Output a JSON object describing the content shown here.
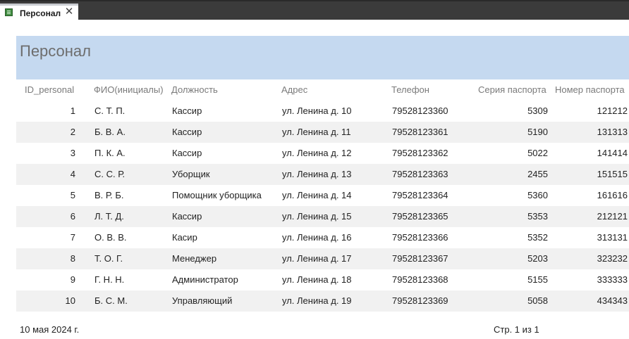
{
  "tab": {
    "label": "Персонал",
    "icon": "report-icon",
    "close_icon": "close-icon"
  },
  "report": {
    "title": "Персонал",
    "header_color": "#c5d9f0",
    "columns": [
      "ID_personal",
      "ФИО(инициалы)",
      "Должность",
      "Адрес",
      "Телефон",
      "Серия паспорта",
      "Номер паспорта"
    ],
    "rows": [
      [
        "1",
        "С. Т. П.",
        "Кассир",
        "ул. Ленина д. 10",
        "79528123360",
        "5309",
        "121212"
      ],
      [
        "2",
        "Б. В. А.",
        "Кассир",
        "ул. Ленина д. 11",
        "79528123361",
        "5190",
        "131313"
      ],
      [
        "3",
        "П. К. А.",
        "Кассир",
        "ул. Ленина д. 12",
        "79528123362",
        "5022",
        "141414"
      ],
      [
        "4",
        "С. С. Р.",
        "Уборщик",
        "ул. Ленина д. 13",
        "79528123363",
        "2455",
        "151515"
      ],
      [
        "5",
        "В. Р. Б.",
        "Помощник уборщика",
        "ул. Ленина д. 14",
        "79528123364",
        "5360",
        "161616"
      ],
      [
        "6",
        "Л. Т. Д.",
        "Кассир",
        "ул. Ленина д. 15",
        "79528123365",
        "5353",
        "212121"
      ],
      [
        "7",
        "О. В. В.",
        "Касир",
        "ул. Ленина д. 16",
        "79528123366",
        "5352",
        "313131"
      ],
      [
        "8",
        "Т. О. Г.",
        "Менеджер",
        "ул. Ленина д. 17",
        "79528123367",
        "5203",
        "323232"
      ],
      [
        "9",
        "Г. Н. Н.",
        "Администратор",
        "ул. Ленина д. 18",
        "79528123368",
        "5155",
        "333333"
      ],
      [
        "10",
        "Б. С. М.",
        "Управляющий",
        "ул. Ленина д. 19",
        "79528123369",
        "5058",
        "434343"
      ]
    ],
    "footer": {
      "date": "10 мая 2024 г.",
      "page": "Стр. 1 из 1"
    }
  }
}
